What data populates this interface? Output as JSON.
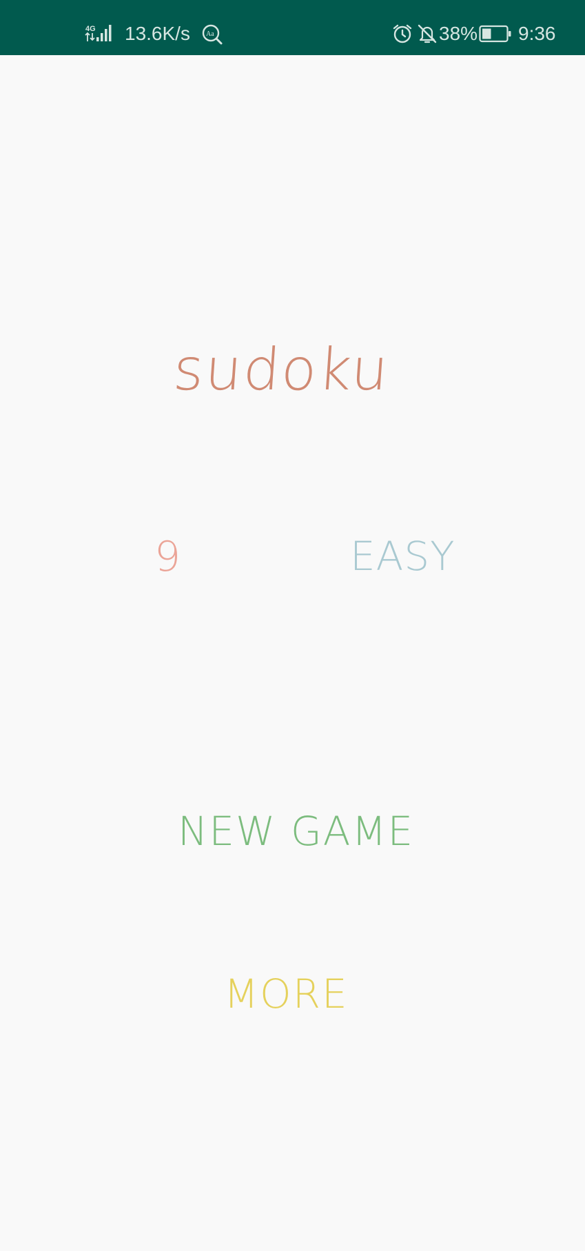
{
  "status_bar": {
    "network_type": "4G",
    "speed": "13.6K/s",
    "battery_percent": "38%",
    "battery_level": 0.38,
    "time": "9:36",
    "icons": [
      "signal-icon",
      "text-search-icon",
      "alarm-icon",
      "bell-off-icon",
      "battery-icon"
    ]
  },
  "main": {
    "title": "sudoku",
    "grid_size": "9",
    "difficulty": "EASY",
    "new_game_label": "NEW GAME",
    "more_label": "MORE"
  },
  "colors": {
    "status_bar_bg": "#015a4e",
    "background": "#f9f9f9",
    "title": "#d08a73",
    "grid_size": "#eba497",
    "difficulty": "#a9c9d1",
    "new_game": "#7cbc7e",
    "more": "#e5d15c"
  }
}
